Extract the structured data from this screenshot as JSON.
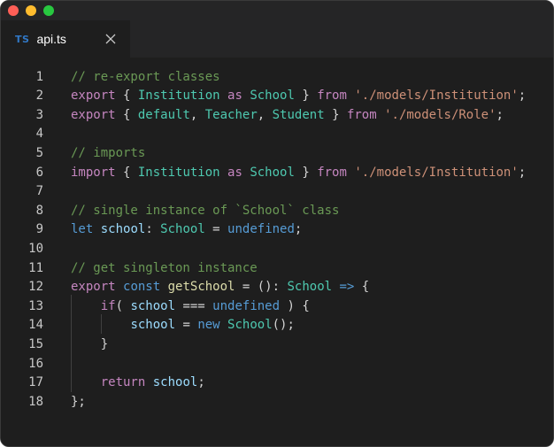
{
  "window": {
    "traffic_lights": [
      "close",
      "minimize",
      "zoom"
    ]
  },
  "tab": {
    "icon_text": "TS",
    "label": "api.ts",
    "close_icon": "close-icon"
  },
  "editor": {
    "lines": [
      {
        "n": "1",
        "tokens": [
          [
            "// re-export classes",
            "comment"
          ]
        ]
      },
      {
        "n": "2",
        "tokens": [
          [
            "export",
            "kw"
          ],
          [
            " { ",
            "punc"
          ],
          [
            "Institution",
            "type"
          ],
          [
            " ",
            "punc"
          ],
          [
            "as",
            "kw"
          ],
          [
            " ",
            "punc"
          ],
          [
            "School",
            "type"
          ],
          [
            " } ",
            "punc"
          ],
          [
            "from",
            "kw"
          ],
          [
            " ",
            "punc"
          ],
          [
            "'./models/Institution'",
            "str"
          ],
          [
            ";",
            "punc"
          ]
        ]
      },
      {
        "n": "3",
        "tokens": [
          [
            "export",
            "kw"
          ],
          [
            " { ",
            "punc"
          ],
          [
            "default",
            "type"
          ],
          [
            ", ",
            "punc"
          ],
          [
            "Teacher",
            "type"
          ],
          [
            ", ",
            "punc"
          ],
          [
            "Student",
            "type"
          ],
          [
            " } ",
            "punc"
          ],
          [
            "from",
            "kw"
          ],
          [
            " ",
            "punc"
          ],
          [
            "'./models/Role'",
            "str"
          ],
          [
            ";",
            "punc"
          ]
        ]
      },
      {
        "n": "4",
        "tokens": []
      },
      {
        "n": "5",
        "tokens": [
          [
            "// imports",
            "comment"
          ]
        ]
      },
      {
        "n": "6",
        "tokens": [
          [
            "import",
            "kw"
          ],
          [
            " { ",
            "punc"
          ],
          [
            "Institution",
            "type"
          ],
          [
            " ",
            "punc"
          ],
          [
            "as",
            "kw"
          ],
          [
            " ",
            "punc"
          ],
          [
            "School",
            "type"
          ],
          [
            " } ",
            "punc"
          ],
          [
            "from",
            "kw"
          ],
          [
            " ",
            "punc"
          ],
          [
            "'./models/Institution'",
            "str"
          ],
          [
            ";",
            "punc"
          ]
        ]
      },
      {
        "n": "7",
        "tokens": []
      },
      {
        "n": "8",
        "tokens": [
          [
            "// single instance of `School` class",
            "comment"
          ]
        ]
      },
      {
        "n": "9",
        "tokens": [
          [
            "let",
            "storage"
          ],
          [
            " ",
            "punc"
          ],
          [
            "school",
            "var"
          ],
          [
            ": ",
            "punc"
          ],
          [
            "School",
            "type"
          ],
          [
            " = ",
            "punc"
          ],
          [
            "undefined",
            "storage"
          ],
          [
            ";",
            "punc"
          ]
        ]
      },
      {
        "n": "10",
        "tokens": []
      },
      {
        "n": "11",
        "tokens": [
          [
            "// get singleton instance",
            "comment"
          ]
        ]
      },
      {
        "n": "12",
        "tokens": [
          [
            "export",
            "kw"
          ],
          [
            " ",
            "punc"
          ],
          [
            "const",
            "storage"
          ],
          [
            " ",
            "punc"
          ],
          [
            "getSchool",
            "fn"
          ],
          [
            " = (): ",
            "punc"
          ],
          [
            "School",
            "type"
          ],
          [
            " ",
            "punc"
          ],
          [
            "=>",
            "storage"
          ],
          [
            " {",
            "punc"
          ]
        ]
      },
      {
        "n": "13",
        "tokens": [
          [
            "    ",
            "punc"
          ],
          [
            "if",
            "kw"
          ],
          [
            "( ",
            "punc"
          ],
          [
            "school",
            "var"
          ],
          [
            " === ",
            "punc"
          ],
          [
            "undefined",
            "storage"
          ],
          [
            " ) {",
            "punc"
          ]
        ]
      },
      {
        "n": "14",
        "tokens": [
          [
            "        ",
            "punc"
          ],
          [
            "school",
            "var"
          ],
          [
            " = ",
            "punc"
          ],
          [
            "new",
            "storage"
          ],
          [
            " ",
            "punc"
          ],
          [
            "School",
            "type"
          ],
          [
            "();",
            "punc"
          ]
        ]
      },
      {
        "n": "15",
        "tokens": [
          [
            "    }",
            "punc"
          ]
        ]
      },
      {
        "n": "16",
        "tokens": []
      },
      {
        "n": "17",
        "tokens": [
          [
            "    ",
            "punc"
          ],
          [
            "return",
            "kw"
          ],
          [
            " ",
            "punc"
          ],
          [
            "school",
            "var"
          ],
          [
            ";",
            "punc"
          ]
        ]
      },
      {
        "n": "18",
        "tokens": [
          [
            "};",
            "punc"
          ]
        ]
      }
    ]
  },
  "colors": {
    "background": "#1e1e1e",
    "comment": "#6a9955",
    "keyword": "#c586c0",
    "type": "#4ec9b0",
    "string": "#ce9178",
    "variable": "#9cdcfe",
    "storage": "#569cd6",
    "function": "#dcdcaa"
  }
}
